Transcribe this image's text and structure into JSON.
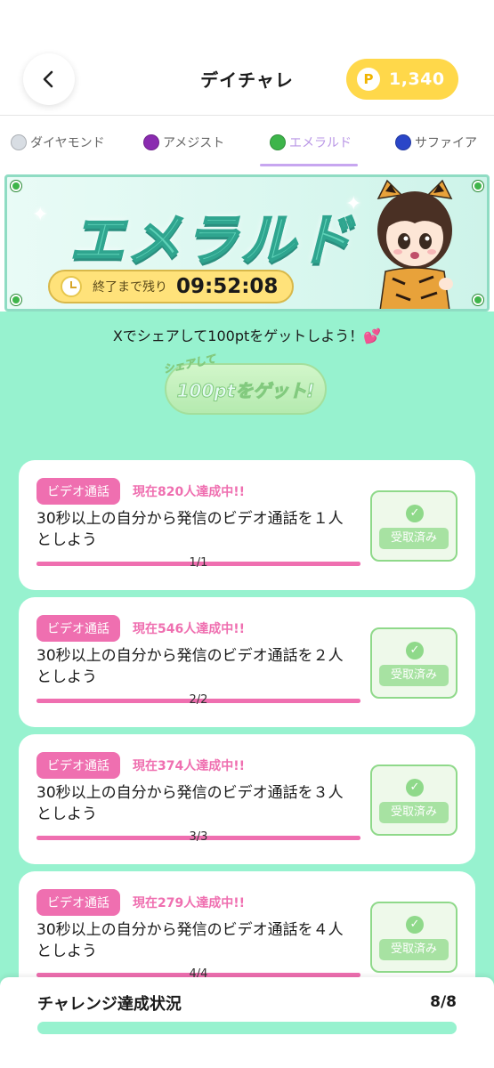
{
  "header": {
    "title": "デイチャレ",
    "points_icon": "P",
    "points": "1,340",
    "back_icon": "chevron-left-icon"
  },
  "tabs": [
    {
      "label": "ダイヤモンド",
      "color": "#d8dde3",
      "active": false
    },
    {
      "label": "アメジスト",
      "color": "#8a2bb0",
      "active": false
    },
    {
      "label": "エメラルド",
      "color": "#3db54a",
      "active": true
    },
    {
      "label": "サファイア",
      "color": "#2a46c8",
      "active": false
    }
  ],
  "banner": {
    "title": "エメラルド",
    "timer_label": "終了まで残り",
    "timer_value": "09:52:08"
  },
  "share": {
    "text": "Xでシェアして100ptをゲットしよう！💕",
    "button_small": "シェアして",
    "button_big": "100ptをゲット!"
  },
  "challenges": [
    {
      "badge": "ビデオ通話",
      "count": "現在820人達成中!!",
      "desc": "30秒以上の自分から発信のビデオ通話を１人としよう",
      "progress": "1/1",
      "progress_fraction": 1.0,
      "status": "受取済み"
    },
    {
      "badge": "ビデオ通話",
      "count": "現在546人達成中!!",
      "desc": "30秒以上の自分から発信のビデオ通話を２人としよう",
      "progress": "2/2",
      "progress_fraction": 1.0,
      "status": "受取済み"
    },
    {
      "badge": "ビデオ通話",
      "count": "現在374人達成中!!",
      "desc": "30秒以上の自分から発信のビデオ通話を３人としよう",
      "progress": "3/3",
      "progress_fraction": 1.0,
      "status": "受取済み"
    },
    {
      "badge": "ビデオ通話",
      "count": "現在279人達成中!!",
      "desc": "30秒以上の自分から発信のビデオ通話を４人としよう",
      "progress": "4/4",
      "progress_fraction": 1.0,
      "status": "受取済み"
    }
  ],
  "footer": {
    "label": "チャレンジ達成状況",
    "value": "8/8",
    "progress_fraction": 1.0
  },
  "colors": {
    "accent_pink": "#ef6fb0",
    "mint": "#97f2cf",
    "gold": "#ffd84a",
    "tab_active": "#b996e6"
  }
}
